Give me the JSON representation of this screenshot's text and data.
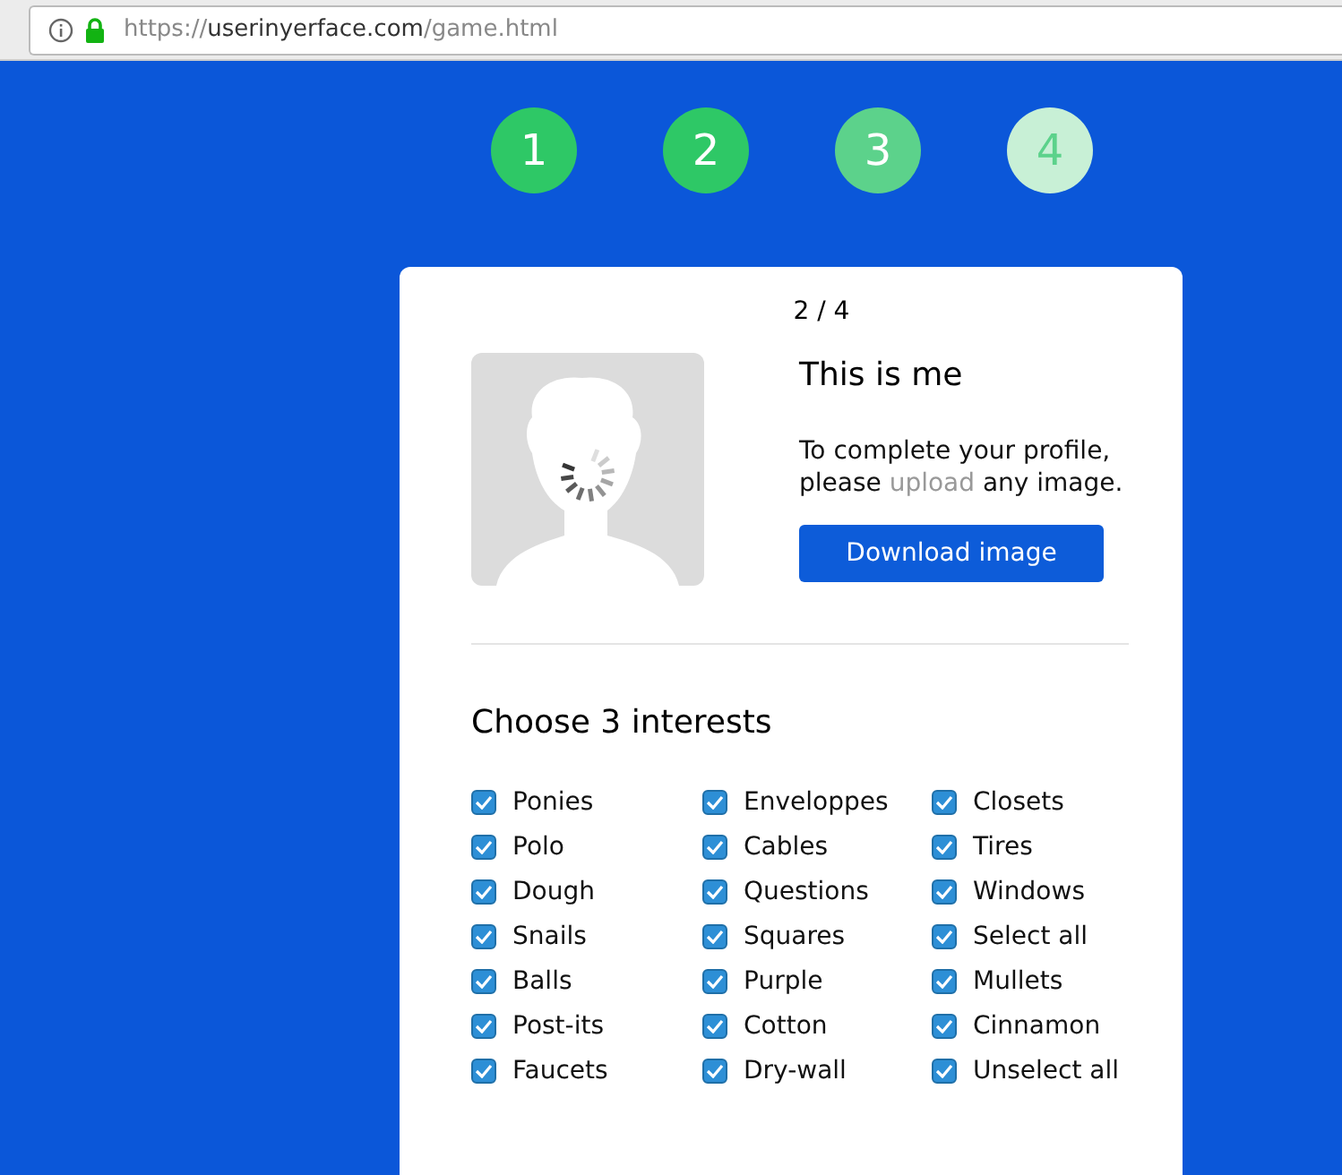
{
  "address_bar": {
    "url_parts": [
      {
        "text": "https://",
        "kind": "dim"
      },
      {
        "text": "userinyerface.com",
        "kind": "main"
      },
      {
        "text": "/game.html",
        "kind": "dim"
      }
    ],
    "secure": true
  },
  "steps": [
    {
      "label": "1",
      "color": "#2ec866"
    },
    {
      "label": "2",
      "color": "#2ec866"
    },
    {
      "label": "3",
      "color": "#5cd28b"
    },
    {
      "label": "4",
      "color": "#c8f0d6"
    }
  ],
  "card": {
    "progress": "2 / 4",
    "title": "This is me",
    "text_before": "To complete your profile, please ",
    "link": "upload",
    "text_after": " any image.",
    "button": "Download image",
    "interests_title": "Choose 3 interests",
    "interests": [
      {
        "label": "Ponies",
        "checked": true
      },
      {
        "label": "Enveloppes",
        "checked": true
      },
      {
        "label": "Closets",
        "checked": true
      },
      {
        "label": "Polo",
        "checked": true
      },
      {
        "label": "Cables",
        "checked": true
      },
      {
        "label": "Tires",
        "checked": true
      },
      {
        "label": "Dough",
        "checked": true
      },
      {
        "label": "Questions",
        "checked": true
      },
      {
        "label": "Windows",
        "checked": true
      },
      {
        "label": "Snails",
        "checked": true
      },
      {
        "label": "Squares",
        "checked": true
      },
      {
        "label": "Select all",
        "checked": true
      },
      {
        "label": "Balls",
        "checked": true
      },
      {
        "label": "Purple",
        "checked": true
      },
      {
        "label": "Mullets",
        "checked": true
      },
      {
        "label": "Post-its",
        "checked": true
      },
      {
        "label": "Cotton",
        "checked": true
      },
      {
        "label": "Cinnamon",
        "checked": true
      },
      {
        "label": "Faucets",
        "checked": true
      },
      {
        "label": "Dry-wall",
        "checked": true
      },
      {
        "label": "Unselect all",
        "checked": true
      }
    ]
  }
}
